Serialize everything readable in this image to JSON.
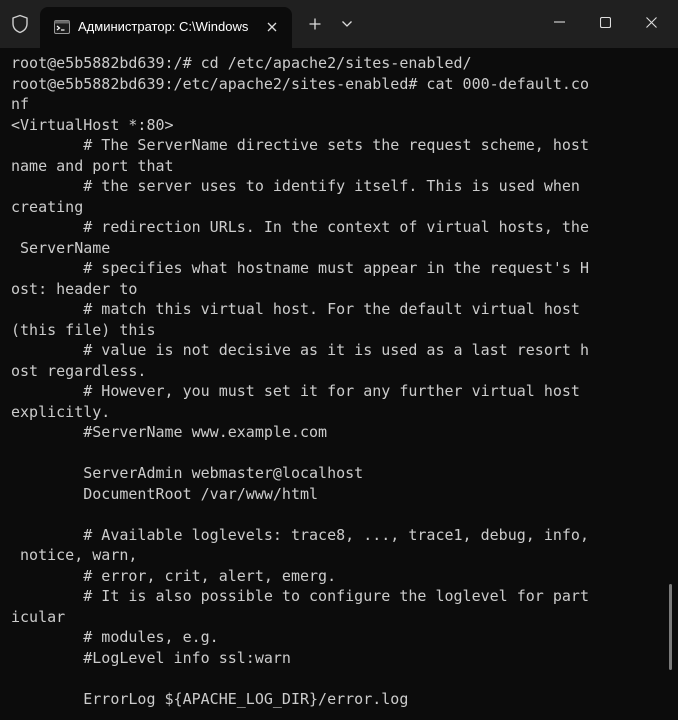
{
  "tab": {
    "title": "Администратор: C:\\Windows"
  },
  "terminal": {
    "lines": [
      "root@e5b5882bd639:/# cd /etc/apache2/sites-enabled/",
      "root@e5b5882bd639:/etc/apache2/sites-enabled# cat 000-default.co",
      "nf",
      "<VirtualHost *:80>",
      "        # The ServerName directive sets the request scheme, host",
      "name and port that",
      "        # the server uses to identify itself. This is used when",
      "creating",
      "        # redirection URLs. In the context of virtual hosts, the",
      " ServerName",
      "        # specifies what hostname must appear in the request's H",
      "ost: header to",
      "        # match this virtual host. For the default virtual host",
      "(this file) this",
      "        # value is not decisive as it is used as a last resort h",
      "ost regardless.",
      "        # However, you must set it for any further virtual host",
      "explicitly.",
      "        #ServerName www.example.com",
      "",
      "        ServerAdmin webmaster@localhost",
      "        DocumentRoot /var/www/html",
      "",
      "        # Available loglevels: trace8, ..., trace1, debug, info,",
      " notice, warn,",
      "        # error, crit, alert, emerg.",
      "        # It is also possible to configure the loglevel for part",
      "icular",
      "        # modules, e.g.",
      "        #LogLevel info ssl:warn",
      "",
      "        ErrorLog ${APACHE_LOG_DIR}/error.log"
    ]
  },
  "icons": {
    "shield": "shield-icon",
    "tab": "terminal-icon",
    "close_tab": "close-icon",
    "new_tab": "plus-icon",
    "dropdown": "chevron-down-icon",
    "minimize": "minimize-icon",
    "maximize": "maximize-icon",
    "close_window": "close-icon"
  },
  "colors": {
    "titlebar": "#202020",
    "terminal_bg": "#0c0c0c",
    "text": "#cccccc"
  }
}
